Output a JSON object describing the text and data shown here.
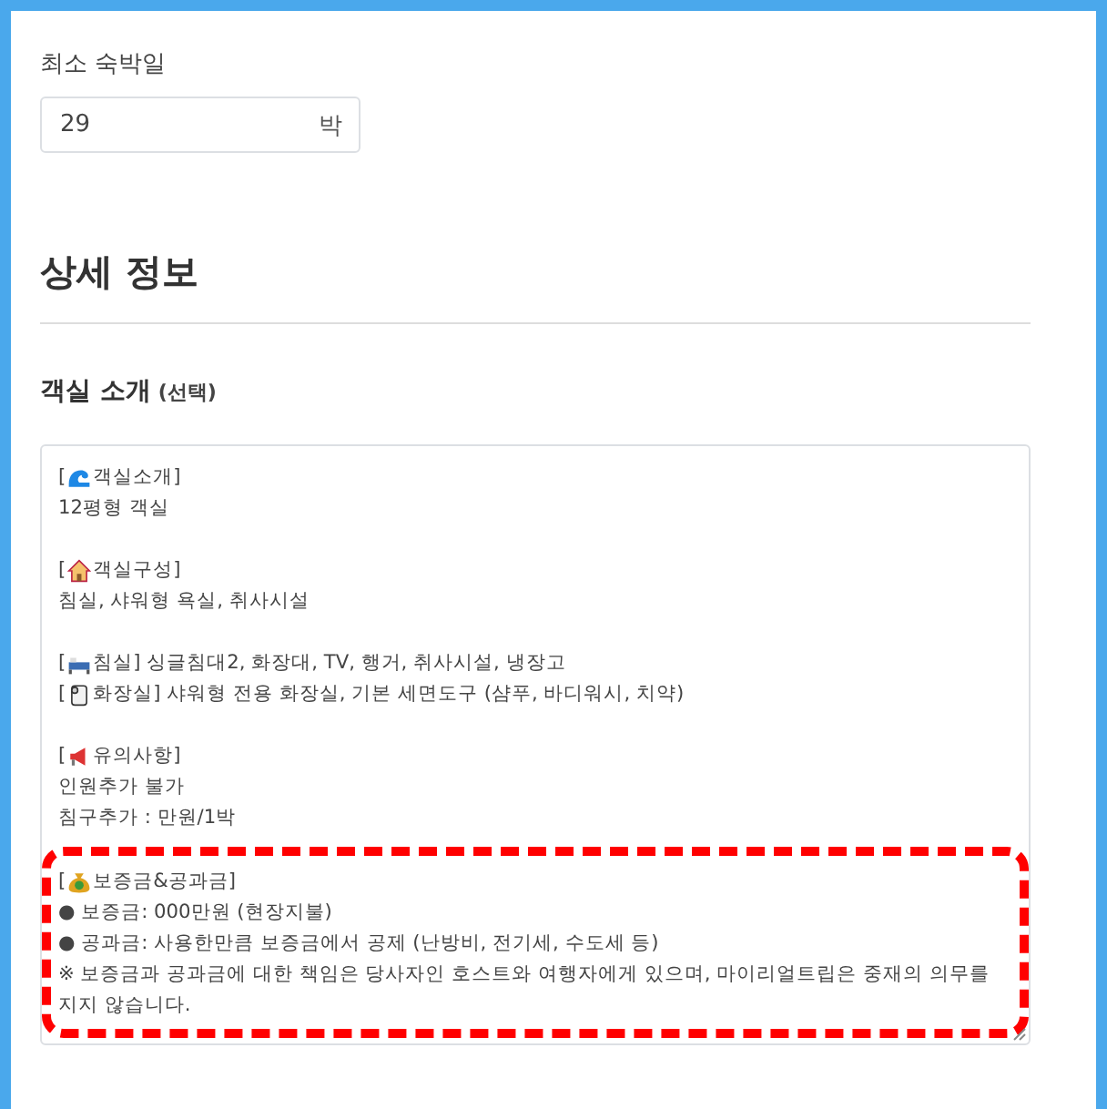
{
  "min_stay": {
    "label": "최소 숙박일",
    "value": "29",
    "unit": "박"
  },
  "section": {
    "title": "상세 정보"
  },
  "room_intro": {
    "label": "객실 소개",
    "hint": "(선택)",
    "paragraphs": [
      {
        "highlighted": false,
        "lines": [
          {
            "kind": "heading",
            "open": "[",
            "text": "객실소개]"
          },
          {
            "kind": "text",
            "text": "12평형 객실"
          }
        ]
      },
      {
        "highlighted": false,
        "lines": [
          {
            "kind": "heading",
            "open": "[",
            "text": "객실구성]"
          },
          {
            "kind": "text",
            "text": "침실, 샤워형 욕실, 취사시설"
          }
        ]
      },
      {
        "highlighted": false,
        "lines": [
          {
            "kind": "heading",
            "open": "[",
            "text": "침실] 싱글침대2, 화장대, TV, 행거, 취사시설, 냉장고"
          },
          {
            "kind": "heading",
            "open": "[",
            "text": "화장실] 샤워형 전용 화장실, 기본 세면도구 (샴푸, 바디워시, 치약)"
          }
        ]
      },
      {
        "highlighted": false,
        "lines": [
          {
            "kind": "heading",
            "open": "[",
            "text": "유의사항]"
          },
          {
            "kind": "text",
            "text": "인원추가 불가"
          },
          {
            "kind": "text",
            "text": "침구추가 : 만원/1박"
          }
        ]
      },
      {
        "highlighted": true,
        "lines": [
          {
            "kind": "heading",
            "open": "[",
            "text": "보증금&공과금]"
          },
          {
            "kind": "text",
            "text": "● 보증금: 000만원 (현장지불)"
          },
          {
            "kind": "text",
            "text": "● 공과금: 사용한만큼 보증금에서 공제 (난방비, 전기세, 수도세 등)"
          },
          {
            "kind": "text",
            "text": "※ 보증금과 공과금에 대한 책임은 당사자인 호스트와 여행자에게 있으며, 마이리얼트립은 중재의 의무를 지지 않습니다."
          }
        ]
      }
    ]
  }
}
